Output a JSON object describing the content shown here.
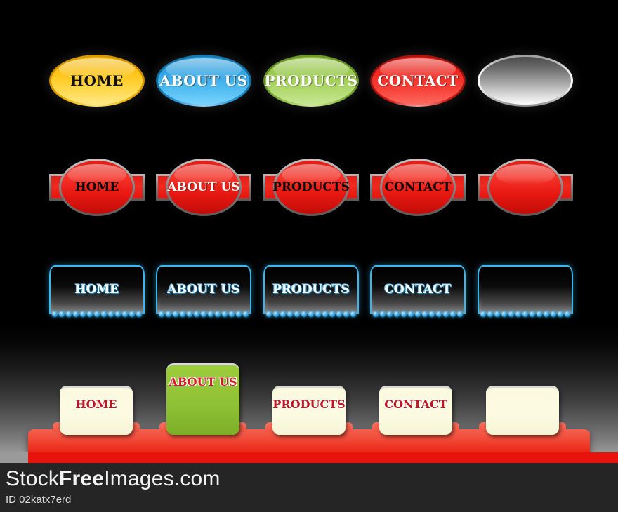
{
  "artwork": {
    "title": "Web navigation button set",
    "background_color": "#000000",
    "columns_x": [
      70,
      222,
      375,
      527,
      680
    ],
    "rows": [
      {
        "name": "glossy-ellipse-row",
        "style": "ellipse",
        "buttons": [
          {
            "label": "HOME",
            "fill": "#ffc61c",
            "text_color": "#111111",
            "variant": "yellow"
          },
          {
            "label": "ABOUT US",
            "fill": "#35a8e6",
            "text_color": "#ffffff",
            "variant": "blue"
          },
          {
            "label": "PRODUCTS",
            "fill": "#9ccb4f",
            "text_color": "#ffffff",
            "variant": "green"
          },
          {
            "label": "CONTACT",
            "fill": "#ef2a22",
            "text_color": "#ffffff",
            "variant": "red"
          },
          {
            "label": "",
            "fill": "#9e9e9e",
            "text_color": "#000000",
            "variant": "silver"
          }
        ]
      },
      {
        "name": "red-slab-row",
        "style": "ellipse-over-bar",
        "buttons": [
          {
            "label": "HOME",
            "fill": "#e81812",
            "text_color": "#0a0a0a",
            "variant": "dark-text"
          },
          {
            "label": "ABOUT US",
            "fill": "#e81812",
            "text_color": "#ffffff",
            "variant": "light-text"
          },
          {
            "label": "PRODUCTS",
            "fill": "#e81812",
            "text_color": "#0a0a0a",
            "variant": "dark-text"
          },
          {
            "label": "CONTACT",
            "fill": "#e81812",
            "text_color": "#0a0a0a",
            "variant": "dark-text"
          },
          {
            "label": "",
            "fill": "#e81812",
            "text_color": "#0a0a0a",
            "variant": "dark-text"
          }
        ]
      },
      {
        "name": "dark-neon-row",
        "style": "dark-panel-with-dots",
        "accent_color": "#39b7ee",
        "dot_count": 13,
        "buttons": [
          {
            "label": "HOME",
            "fill": "#1a1a1a",
            "text_color": "#ffffff"
          },
          {
            "label": "ABOUT US",
            "fill": "#1a1a1a",
            "text_color": "#ffffff"
          },
          {
            "label": "PRODUCTS",
            "fill": "#1a1a1a",
            "text_color": "#ffffff"
          },
          {
            "label": "CONTACT",
            "fill": "#1a1a1a",
            "text_color": "#ffffff"
          },
          {
            "label": "",
            "fill": "#1a1a1a",
            "text_color": "#ffffff"
          }
        ]
      },
      {
        "name": "card-row",
        "style": "card-on-red-bar",
        "bar_color": "#ea1f13",
        "buttons": [
          {
            "label": "HOME",
            "fill": "#fcfbe2",
            "text_color": "#c0161d",
            "variant": "cream",
            "raised": false
          },
          {
            "label": "ABOUT US",
            "fill": "#8fc235",
            "text_color": "#d8191f",
            "variant": "green",
            "raised": true
          },
          {
            "label": "PRODUCTS",
            "fill": "#fcfbe2",
            "text_color": "#c0161d",
            "variant": "cream",
            "raised": false
          },
          {
            "label": "CONTACT",
            "fill": "#fcfbe2",
            "text_color": "#c0161d",
            "variant": "cream",
            "raised": false
          },
          {
            "label": "",
            "fill": "#fcfbe2",
            "text_color": "#c0161d",
            "variant": "cream",
            "raised": false
          }
        ]
      }
    ]
  },
  "footer": {
    "brand_prefix": "Stock",
    "brand_bold": "Free",
    "brand_suffix": "Images.com",
    "id_text": "ID 02katx7erd",
    "background_color": "#252526",
    "text_color": "#f2f2f2"
  }
}
